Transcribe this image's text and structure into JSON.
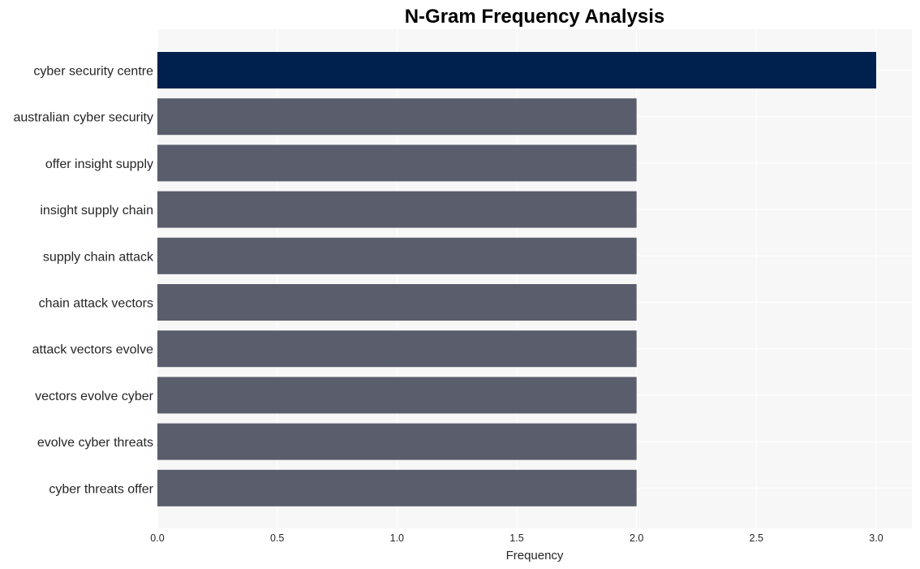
{
  "chart_data": {
    "type": "bar",
    "orientation": "horizontal",
    "title": "N-Gram Frequency Analysis",
    "xlabel": "Frequency",
    "ylabel": "",
    "xlim": [
      0,
      3.15
    ],
    "xticks": [
      0.0,
      0.5,
      1.0,
      1.5,
      2.0,
      2.5,
      3.0
    ],
    "xtick_labels": [
      "0.0",
      "0.5",
      "1.0",
      "1.5",
      "2.0",
      "2.5",
      "3.0"
    ],
    "grid": true,
    "categories": [
      "cyber security centre",
      "australian cyber security",
      "offer insight supply",
      "insight supply chain",
      "supply chain attack",
      "chain attack vectors",
      "attack vectors evolve",
      "vectors evolve cyber",
      "evolve cyber threats",
      "cyber threats offer"
    ],
    "values": [
      3,
      2,
      2,
      2,
      2,
      2,
      2,
      2,
      2,
      2
    ],
    "colors": {
      "highlight": "#00214d",
      "default": "#595d6c",
      "plot_background": "#f7f7f7",
      "grid": "#ffffff"
    }
  }
}
